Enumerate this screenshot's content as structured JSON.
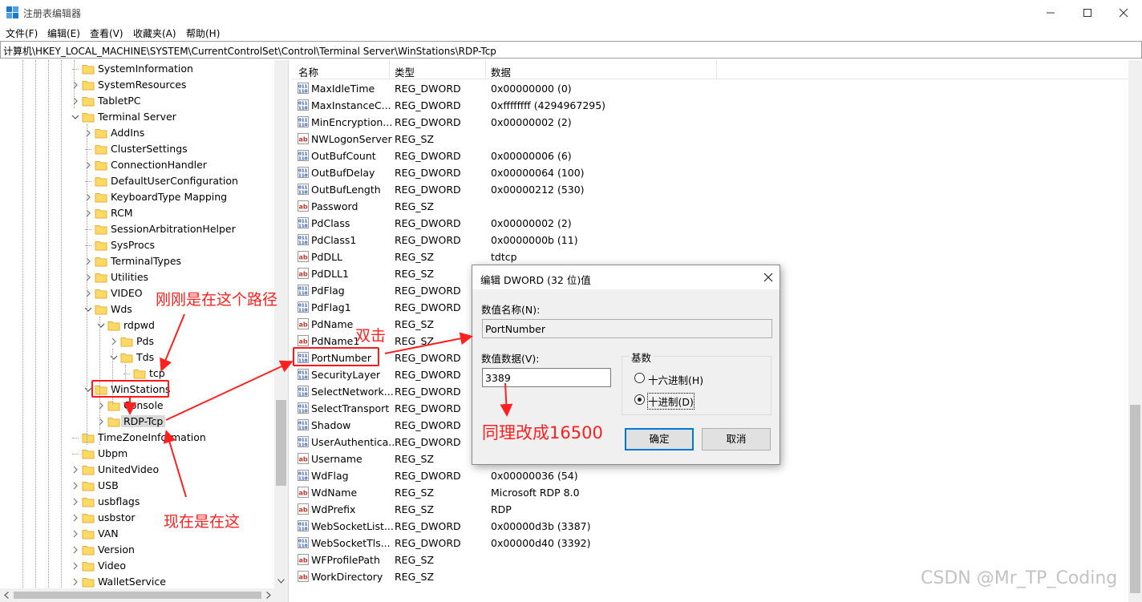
{
  "window": {
    "title": "注册表编辑器",
    "controls": [
      "minimize-icon",
      "maximize-icon",
      "close-icon"
    ]
  },
  "menu": [
    {
      "label": "文件(F)"
    },
    {
      "label": "编辑(E)"
    },
    {
      "label": "查看(V)"
    },
    {
      "label": "收藏夹(A)"
    },
    {
      "label": "帮助(H)"
    }
  ],
  "address": {
    "path": "计算机\\HKEY_LOCAL_MACHINE\\SYSTEM\\CurrentControlSet\\Control\\Terminal Server\\WinStations\\RDP-Tcp"
  },
  "tree": {
    "items": [
      {
        "label": "SystemInformation",
        "expander": "none"
      },
      {
        "label": "SystemResources",
        "expander": "collapsed"
      },
      {
        "label": "TabletPC",
        "expander": "collapsed"
      },
      {
        "label": "Terminal Server",
        "expander": "expanded"
      },
      {
        "label": "AddIns",
        "expander": "collapsed"
      },
      {
        "label": "ClusterSettings",
        "expander": "none"
      },
      {
        "label": "ConnectionHandler",
        "expander": "collapsed"
      },
      {
        "label": "DefaultUserConfiguration",
        "expander": "none"
      },
      {
        "label": "KeyboardType Mapping",
        "expander": "collapsed"
      },
      {
        "label": "RCM",
        "expander": "collapsed"
      },
      {
        "label": "SessionArbitrationHelper",
        "expander": "none"
      },
      {
        "label": "SysProcs",
        "expander": "none"
      },
      {
        "label": "TerminalTypes",
        "expander": "collapsed"
      },
      {
        "label": "Utilities",
        "expander": "collapsed"
      },
      {
        "label": "VIDEO",
        "expander": "collapsed"
      },
      {
        "label": "Wds",
        "expander": "expanded"
      },
      {
        "label": "rdpwd",
        "expander": "expanded"
      },
      {
        "label": "Pds",
        "expander": "collapsed"
      },
      {
        "label": "Tds",
        "expander": "expanded"
      },
      {
        "label": "tcp",
        "expander": "none"
      },
      {
        "label": "WinStations",
        "expander": "expanded"
      },
      {
        "label": "Console",
        "expander": "collapsed"
      },
      {
        "label": "RDP-Tcp",
        "expander": "collapsed",
        "selected": true
      },
      {
        "label": "TimeZoneInformation",
        "expander": "none"
      },
      {
        "label": "Ubpm",
        "expander": "none"
      },
      {
        "label": "UnitedVideo",
        "expander": "collapsed"
      },
      {
        "label": "USB",
        "expander": "collapsed"
      },
      {
        "label": "usbflags",
        "expander": "collapsed"
      },
      {
        "label": "usbstor",
        "expander": "collapsed"
      },
      {
        "label": "VAN",
        "expander": "collapsed"
      },
      {
        "label": "Version",
        "expander": "collapsed"
      },
      {
        "label": "Video",
        "expander": "collapsed"
      },
      {
        "label": "WalletService",
        "expander": "collapsed"
      }
    ]
  },
  "list": {
    "columns": {
      "name": "名称",
      "type": "类型",
      "data": "数据"
    },
    "rows": [
      {
        "name": "MaxIdleTime",
        "type": "REG_DWORD",
        "data": "0x00000000 (0)"
      },
      {
        "name": "MaxInstanceC...",
        "type": "REG_DWORD",
        "data": "0xffffffff (4294967295)"
      },
      {
        "name": "MinEncryption...",
        "type": "REG_DWORD",
        "data": "0x00000002 (2)"
      },
      {
        "name": "NWLogonServer",
        "type": "REG_SZ",
        "data": ""
      },
      {
        "name": "OutBufCount",
        "type": "REG_DWORD",
        "data": "0x00000006 (6)"
      },
      {
        "name": "OutBufDelay",
        "type": "REG_DWORD",
        "data": "0x00000064 (100)"
      },
      {
        "name": "OutBufLength",
        "type": "REG_DWORD",
        "data": "0x00000212 (530)"
      },
      {
        "name": "Password",
        "type": "REG_SZ",
        "data": ""
      },
      {
        "name": "PdClass",
        "type": "REG_DWORD",
        "data": "0x00000002 (2)"
      },
      {
        "name": "PdClass1",
        "type": "REG_DWORD",
        "data": "0x0000000b (11)"
      },
      {
        "name": "PdDLL",
        "type": "REG_SZ",
        "data": "tdtcp"
      },
      {
        "name": "PdDLL1",
        "type": "REG_SZ",
        "data": ""
      },
      {
        "name": "PdFlag",
        "type": "REG_DWORD",
        "data": ""
      },
      {
        "name": "PdFlag1",
        "type": "REG_DWORD",
        "data": ""
      },
      {
        "name": "PdName",
        "type": "REG_SZ",
        "data": ""
      },
      {
        "name": "PdName1",
        "type": "REG_SZ",
        "data": ""
      },
      {
        "name": "PortNumber",
        "type": "REG_DWORD",
        "data": "",
        "highlighted": true
      },
      {
        "name": "SecurityLayer",
        "type": "REG_DWORD",
        "data": ""
      },
      {
        "name": "SelectNetwork...",
        "type": "REG_DWORD",
        "data": ""
      },
      {
        "name": "SelectTransport",
        "type": "REG_DWORD",
        "data": ""
      },
      {
        "name": "Shadow",
        "type": "REG_DWORD",
        "data": ""
      },
      {
        "name": "UserAuthentica...",
        "type": "REG_DWORD",
        "data": ""
      },
      {
        "name": "Username",
        "type": "REG_SZ",
        "data": ""
      },
      {
        "name": "WdFlag",
        "type": "REG_DWORD",
        "data": "0x00000036 (54)"
      },
      {
        "name": "WdName",
        "type": "REG_SZ",
        "data": "Microsoft RDP 8.0"
      },
      {
        "name": "WdPrefix",
        "type": "REG_SZ",
        "data": "RDP"
      },
      {
        "name": "WebSocketList...",
        "type": "REG_DWORD",
        "data": "0x00000d3b (3387)"
      },
      {
        "name": "WebSocketTls...",
        "type": "REG_DWORD",
        "data": "0x00000d40 (3392)"
      },
      {
        "name": "WFProfilePath",
        "type": "REG_SZ",
        "data": ""
      },
      {
        "name": "WorkDirectory",
        "type": "REG_SZ",
        "data": ""
      }
    ]
  },
  "dialog": {
    "title": "编辑 DWORD (32 位)值",
    "name_label": "数值名称(N):",
    "name_value": "PortNumber",
    "data_label": "数值数据(V):",
    "data_value": "3389",
    "base_label": "基数",
    "hex_label": "十六进制(H)",
    "dec_label": "十进制(D)",
    "selected_base": "dec",
    "ok_label": "确定",
    "cancel_label": "取消"
  },
  "annotations": {
    "previous_path": "刚刚是在这个路径",
    "double_click": "双击",
    "change_to": "同理改成16500",
    "now_here": "现在是在这",
    "color": "#ff2020"
  },
  "watermark": "CSDN @Mr_TP_Coding",
  "colors": {
    "folder": "#ffd966",
    "folder_edge": "#e0b23a",
    "selection": "#d9d9d9",
    "dialog_bg": "#f0f0f0",
    "accent": "#0078d7"
  }
}
